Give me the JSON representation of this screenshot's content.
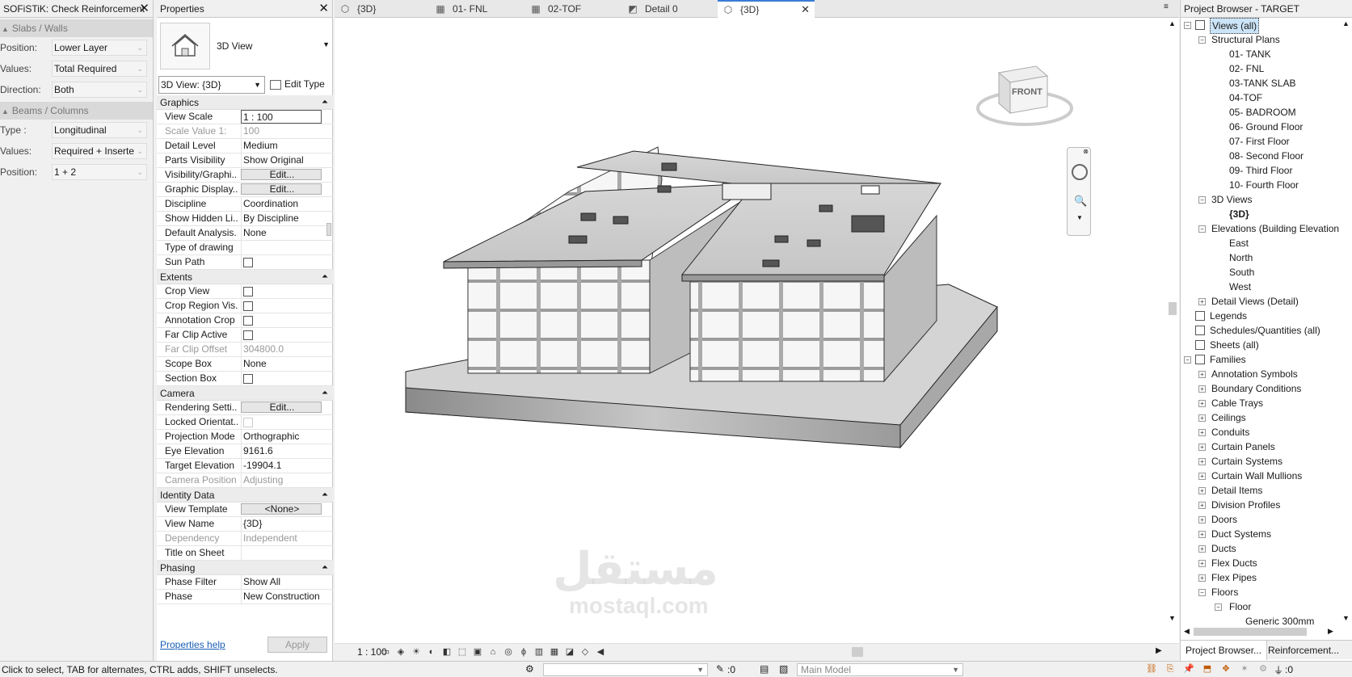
{
  "sofistik": {
    "title": "SOFiSTiK: Check Reinforcement",
    "sections": [
      {
        "label": "Slabs / Walls",
        "rows": [
          {
            "label": "Position:",
            "value": "Lower Layer"
          },
          {
            "label": "Values:",
            "value": "Total Required"
          },
          {
            "label": "Direction:",
            "value": "Both"
          }
        ]
      },
      {
        "label": "Beams / Columns",
        "rows": [
          {
            "label": "Type :",
            "value": "Longitudinal"
          },
          {
            "label": "Values:",
            "value": "Required + Inserte"
          },
          {
            "label": "Position:",
            "value": "1 + 2"
          }
        ]
      }
    ]
  },
  "properties": {
    "title": "Properties",
    "type_name": "3D View",
    "view_selector": "3D View: {3D}",
    "edit_type": "Edit Type",
    "help_link": "Properties help",
    "apply": "Apply",
    "groups": [
      {
        "name": "Graphics",
        "rows": [
          {
            "k": "View Scale",
            "v": "1 : 100",
            "kind": "input"
          },
          {
            "k": "Scale Value    1:",
            "v": "100",
            "kind": "dis"
          },
          {
            "k": "Detail Level",
            "v": "Medium"
          },
          {
            "k": "Parts Visibility",
            "v": "Show Original"
          },
          {
            "k": "Visibility/Graphi...",
            "v": "Edit...",
            "kind": "btn"
          },
          {
            "k": "Graphic Display...",
            "v": "Edit...",
            "kind": "btn"
          },
          {
            "k": "Discipline",
            "v": "Coordination"
          },
          {
            "k": "Show Hidden Li...",
            "v": "By Discipline"
          },
          {
            "k": "Default Analysis...",
            "v": "None"
          },
          {
            "k": "Type of drawing",
            "v": ""
          },
          {
            "k": "Sun Path",
            "v": "",
            "kind": "chk"
          }
        ]
      },
      {
        "name": "Extents",
        "rows": [
          {
            "k": "Crop View",
            "v": "",
            "kind": "chk"
          },
          {
            "k": "Crop Region Vis...",
            "v": "",
            "kind": "chk"
          },
          {
            "k": "Annotation Crop",
            "v": "",
            "kind": "chk"
          },
          {
            "k": "Far Clip Active",
            "v": "",
            "kind": "chk"
          },
          {
            "k": "Far Clip Offset",
            "v": "304800.0",
            "kind": "dis"
          },
          {
            "k": "Scope Box",
            "v": "None"
          },
          {
            "k": "Section Box",
            "v": "",
            "kind": "chk"
          }
        ]
      },
      {
        "name": "Camera",
        "rows": [
          {
            "k": "Rendering Setti...",
            "v": "Edit...",
            "kind": "btn"
          },
          {
            "k": "Locked Orientat...",
            "v": "",
            "kind": "chkdis"
          },
          {
            "k": "Projection Mode",
            "v": "Orthographic"
          },
          {
            "k": "Eye Elevation",
            "v": "9161.6"
          },
          {
            "k": "Target Elevation",
            "v": "-19904.1"
          },
          {
            "k": "Camera Position",
            "v": "Adjusting",
            "kind": "dis"
          }
        ]
      },
      {
        "name": "Identity Data",
        "rows": [
          {
            "k": "View Template",
            "v": "<None>",
            "kind": "btn"
          },
          {
            "k": "View Name",
            "v": "{3D}"
          },
          {
            "k": "Dependency",
            "v": "Independent",
            "kind": "dis"
          },
          {
            "k": "Title on Sheet",
            "v": ""
          }
        ]
      },
      {
        "name": "Phasing",
        "rows": [
          {
            "k": "Phase Filter",
            "v": "Show All"
          },
          {
            "k": "Phase",
            "v": "New Construction"
          }
        ]
      }
    ]
  },
  "tabs": [
    {
      "label": "{3D}",
      "icon": "3d-view-icon",
      "glyph": "⬡"
    },
    {
      "label": "01- FNL",
      "icon": "floor-plan-icon",
      "glyph": "▦"
    },
    {
      "label": "02-TOF",
      "icon": "floor-plan-icon",
      "glyph": "▦"
    },
    {
      "label": "Detail 0",
      "icon": "detail-view-icon",
      "glyph": "◩"
    },
    {
      "label": "{3D}",
      "icon": "3d-view-icon",
      "glyph": "⬡",
      "active": true
    }
  ],
  "view": {
    "scale": "1 : 100",
    "viewcube_face": "FRONT",
    "watermark_ar": "مستقل",
    "watermark_en": "mostaql.com"
  },
  "browser": {
    "title": "Project Browser - TARGET",
    "tabs": [
      "Project Browser...",
      "Reinforcement..."
    ],
    "nodes": [
      {
        "t": "Views (all)",
        "lvl": 0,
        "ex": "-",
        "sel": true
      },
      {
        "t": "Structural Plans",
        "lvl": 1,
        "ex": "-"
      },
      {
        "t": "01- TANK",
        "lvl": 2
      },
      {
        "t": "02- FNL",
        "lvl": 2
      },
      {
        "t": "03-TANK SLAB",
        "lvl": 2
      },
      {
        "t": "04-TOF",
        "lvl": 2
      },
      {
        "t": "05- BADROOM",
        "lvl": 2
      },
      {
        "t": "06- Ground Floor",
        "lvl": 2
      },
      {
        "t": "07- First Floor",
        "lvl": 2
      },
      {
        "t": "08- Second Floor",
        "lvl": 2
      },
      {
        "t": "09- Third Floor",
        "lvl": 2
      },
      {
        "t": "10- Fourth Floor",
        "lvl": 2
      },
      {
        "t": "3D Views",
        "lvl": 1,
        "ex": "-"
      },
      {
        "t": "{3D}",
        "lvl": 2,
        "bold": true
      },
      {
        "t": "Elevations (Building Elevation)",
        "lvl": 1,
        "ex": "-"
      },
      {
        "t": "East",
        "lvl": 2
      },
      {
        "t": "North",
        "lvl": 2
      },
      {
        "t": "South",
        "lvl": 2
      },
      {
        "t": "West",
        "lvl": 2
      },
      {
        "t": "Detail Views (Detail)",
        "lvl": 1,
        "ex": "+"
      },
      {
        "t": "Legends",
        "lvl": 0
      },
      {
        "t": "Schedules/Quantities (all)",
        "lvl": 0
      },
      {
        "t": "Sheets (all)",
        "lvl": 0
      },
      {
        "t": "Families",
        "lvl": 0,
        "ex": "-"
      },
      {
        "t": "Annotation Symbols",
        "lvl": 1,
        "ex": "+"
      },
      {
        "t": "Boundary Conditions",
        "lvl": 1,
        "ex": "+"
      },
      {
        "t": "Cable Trays",
        "lvl": 1,
        "ex": "+"
      },
      {
        "t": "Ceilings",
        "lvl": 1,
        "ex": "+"
      },
      {
        "t": "Conduits",
        "lvl": 1,
        "ex": "+"
      },
      {
        "t": "Curtain Panels",
        "lvl": 1,
        "ex": "+"
      },
      {
        "t": "Curtain Systems",
        "lvl": 1,
        "ex": "+"
      },
      {
        "t": "Curtain Wall Mullions",
        "lvl": 1,
        "ex": "+"
      },
      {
        "t": "Detail Items",
        "lvl": 1,
        "ex": "+"
      },
      {
        "t": "Division Profiles",
        "lvl": 1,
        "ex": "+"
      },
      {
        "t": "Doors",
        "lvl": 1,
        "ex": "+"
      },
      {
        "t": "Duct Systems",
        "lvl": 1,
        "ex": "+"
      },
      {
        "t": "Ducts",
        "lvl": 1,
        "ex": "+"
      },
      {
        "t": "Flex Ducts",
        "lvl": 1,
        "ex": "+"
      },
      {
        "t": "Flex Pipes",
        "lvl": 1,
        "ex": "+"
      },
      {
        "t": "Floors",
        "lvl": 1,
        "ex": "-"
      },
      {
        "t": "Floor",
        "lvl": 2,
        "ex": "-"
      },
      {
        "t": "Generic 300mm",
        "lvl": 3
      }
    ]
  },
  "status": {
    "message": "Click to select, TAB for alternates, CTRL adds, SHIFT unselects.",
    "count": ":0",
    "model": "Main Model",
    "filter": ":0"
  }
}
